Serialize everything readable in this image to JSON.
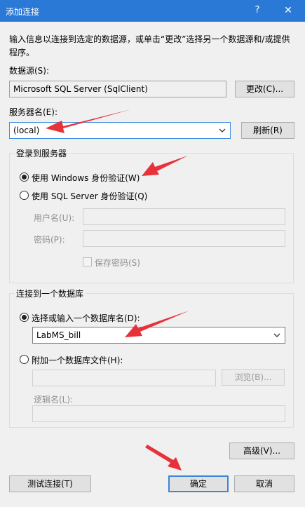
{
  "window": {
    "title": "添加连接",
    "help": "?",
    "close": "✕"
  },
  "description": "输入信息以连接到选定的数据源，或单击“更改”选择另一个数据源和/或提供程序。",
  "datasource": {
    "label": "数据源(S):",
    "value": "Microsoft SQL Server (SqlClient)",
    "change_button": "更改(C)..."
  },
  "server": {
    "label": "服务器名(E):",
    "value": "(local)",
    "refresh_button": "刷新(R)"
  },
  "login_group": {
    "title": "登录到服务器",
    "windows_auth": "使用 Windows 身份验证(W)",
    "sql_auth": "使用 SQL Server 身份验证(Q)",
    "username_label": "用户名(U):",
    "password_label": "密码(P):",
    "save_password": "保存密码(S)"
  },
  "db_group": {
    "title": "连接到一个数据库",
    "select_db_label": "选择或输入一个数据库名(D):",
    "db_value": "LabMS_bill",
    "attach_file_label": "附加一个数据库文件(H):",
    "browse_button": "浏览(B)...",
    "logical_name_label": "逻辑名(L):"
  },
  "footer": {
    "advanced_button": "高级(V)...",
    "test_button": "测试连接(T)",
    "ok_button": "确定",
    "cancel_button": "取消"
  },
  "colors": {
    "titlebar": "#2b79d7",
    "arrow": "#e8323a",
    "focus": "#3a86d8"
  }
}
